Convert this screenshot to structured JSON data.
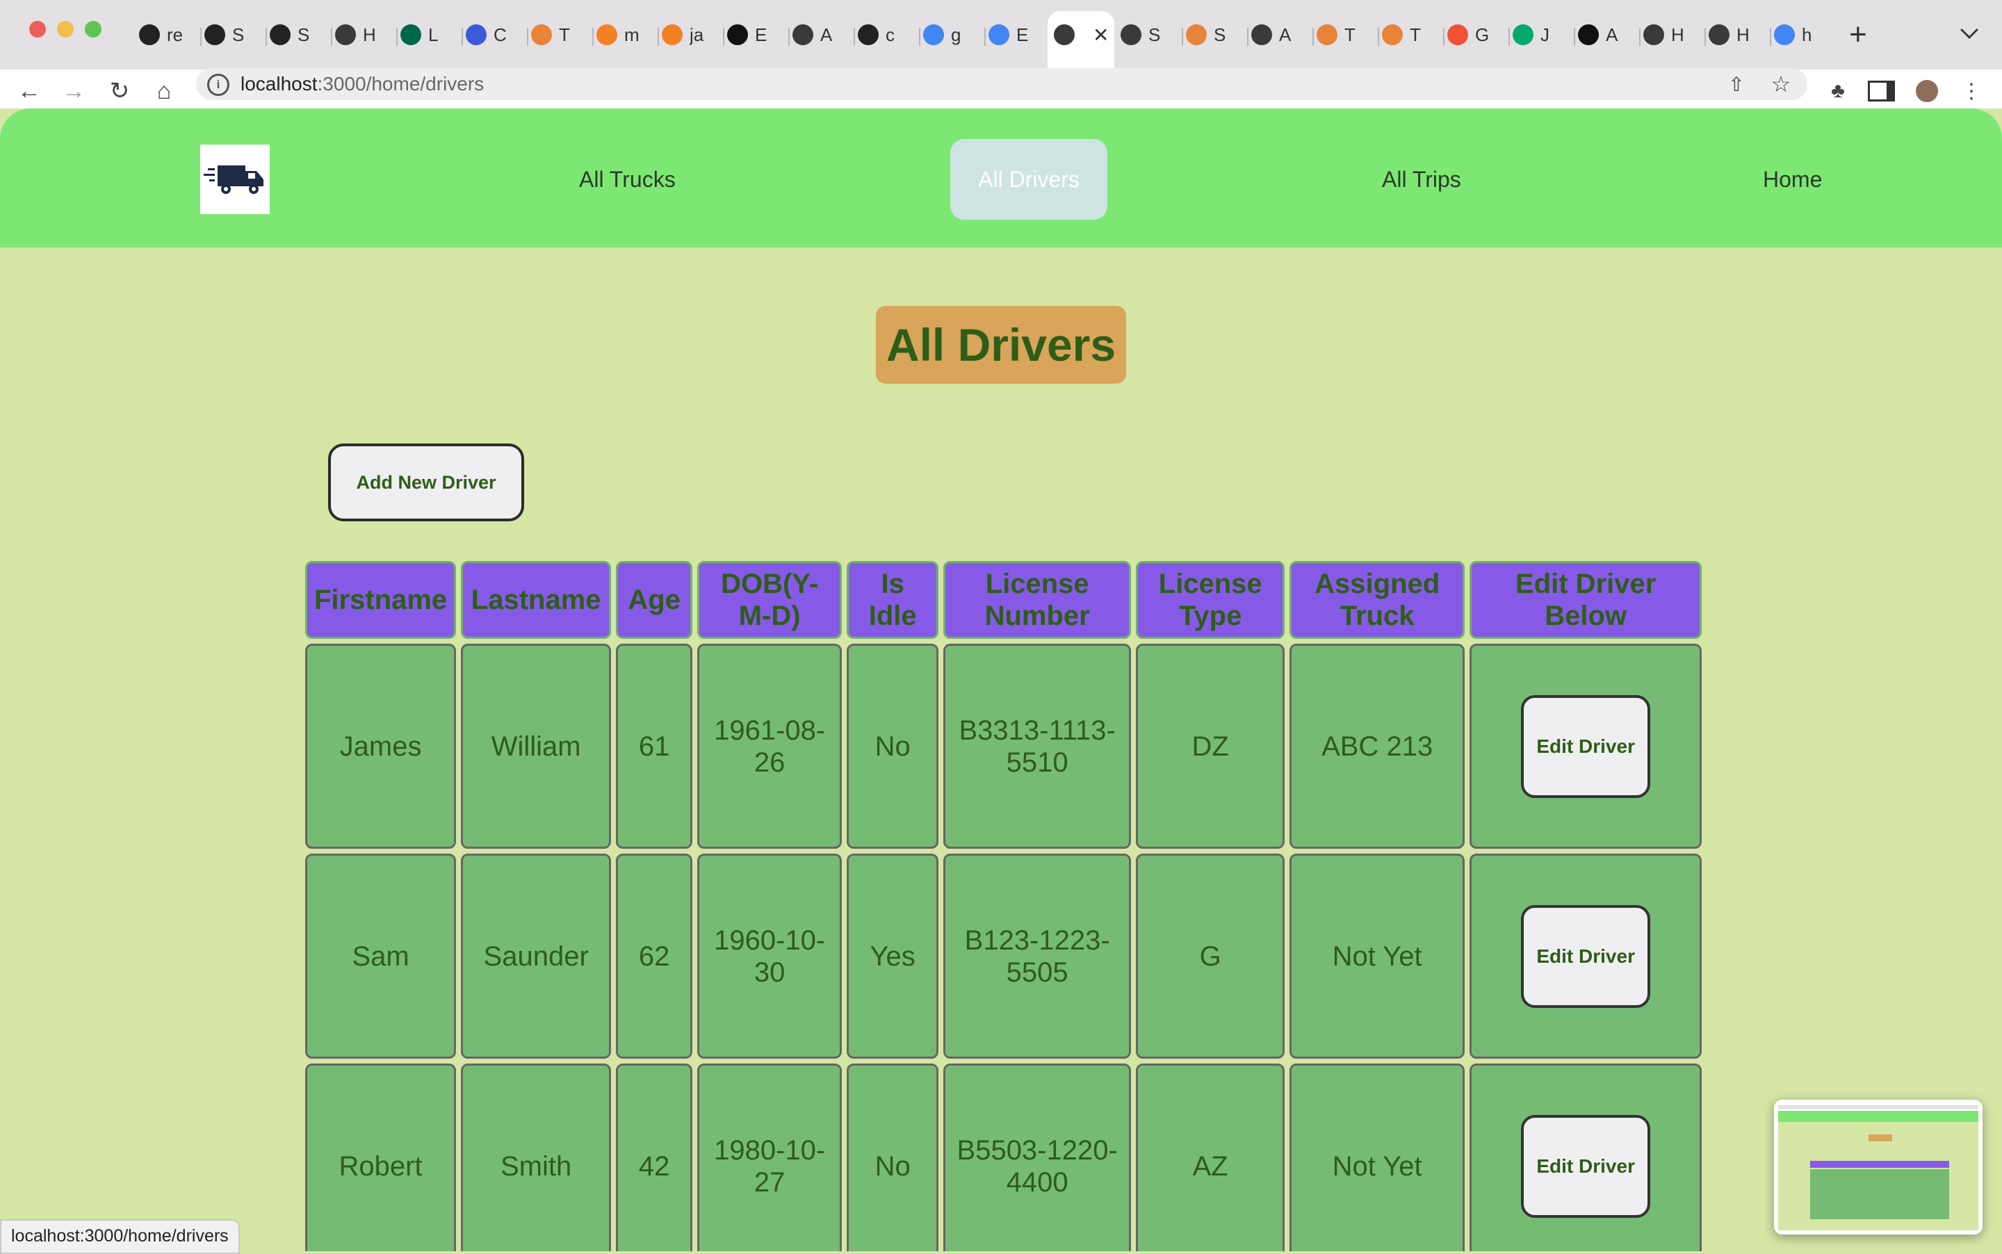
{
  "browser": {
    "tabs": [
      {
        "title": "re",
        "icon": "github-icon"
      },
      {
        "title": "S",
        "icon": "github-icon"
      },
      {
        "title": "S",
        "icon": "github-icon"
      },
      {
        "title": "H",
        "icon": "globe-icon"
      },
      {
        "title": "L",
        "icon": "mongodb-icon"
      },
      {
        "title": "C",
        "icon": "api-icon"
      },
      {
        "title": "T",
        "icon": "app-icon"
      },
      {
        "title": "m",
        "icon": "stackoverflow-icon"
      },
      {
        "title": "ja",
        "icon": "stackoverflow-icon"
      },
      {
        "title": "E",
        "icon": "medium-icon"
      },
      {
        "title": "A",
        "icon": "globe-icon"
      },
      {
        "title": "c",
        "icon": "github-icon"
      },
      {
        "title": "g",
        "icon": "google-icon"
      },
      {
        "title": "E",
        "icon": "google-cloud-icon"
      },
      {
        "title": "",
        "icon": "globe-icon",
        "active": true
      },
      {
        "title": "S",
        "icon": "globe-icon"
      },
      {
        "title": "S",
        "icon": "app-icon"
      },
      {
        "title": "A",
        "icon": "globe-icon"
      },
      {
        "title": "T",
        "icon": "app-icon"
      },
      {
        "title": "T",
        "icon": "app-icon"
      },
      {
        "title": "G",
        "icon": "git-icon"
      },
      {
        "title": "J",
        "icon": "w3schools-icon"
      },
      {
        "title": "A",
        "icon": "medium-icon"
      },
      {
        "title": "H",
        "icon": "globe-icon"
      },
      {
        "title": "H",
        "icon": "globe-icon"
      },
      {
        "title": "h",
        "icon": "google-icon"
      }
    ],
    "url_host": "localhost",
    "url_path": ":3000/home/drivers",
    "status_url": "localhost:3000/home/drivers"
  },
  "nav": {
    "links": [
      "All Trucks",
      "All Drivers",
      "All Trips",
      "Home"
    ],
    "active": "All Drivers",
    "logo_icon": "delivery-truck-icon"
  },
  "main": {
    "title": "All Drivers",
    "add_button": "Add New Driver",
    "columns": [
      "Firstname",
      "Lastname",
      "Age",
      "DOB(Y-M-D)",
      "Is Idle",
      "License Number",
      "License Type",
      "Assigned Truck",
      "Edit Driver Below"
    ],
    "rows": [
      {
        "first": "James",
        "last": "William",
        "age": "61",
        "dob": "1961-08-26",
        "idle": "No",
        "license": "B3313-1113-5510",
        "type": "DZ",
        "truck": "ABC 213"
      },
      {
        "first": "Sam",
        "last": "Saunder",
        "age": "62",
        "dob": "1960-10-30",
        "idle": "Yes",
        "license": "B123-1223-5505",
        "type": "G",
        "truck": "Not Yet"
      },
      {
        "first": "Robert",
        "last": "Smith",
        "age": "42",
        "dob": "1980-10-27",
        "idle": "No",
        "license": "B5503-1220-4400",
        "type": "AZ",
        "truck": "Not Yet"
      }
    ],
    "edit_button": "Edit Driver"
  },
  "colors": {
    "navbar": "#7ce873",
    "background": "#d5e6a5",
    "header_cells": "#865ae6",
    "body_cells": "#76bb74",
    "title_badge": "#d8a55a",
    "text_green": "#2d5d18"
  }
}
